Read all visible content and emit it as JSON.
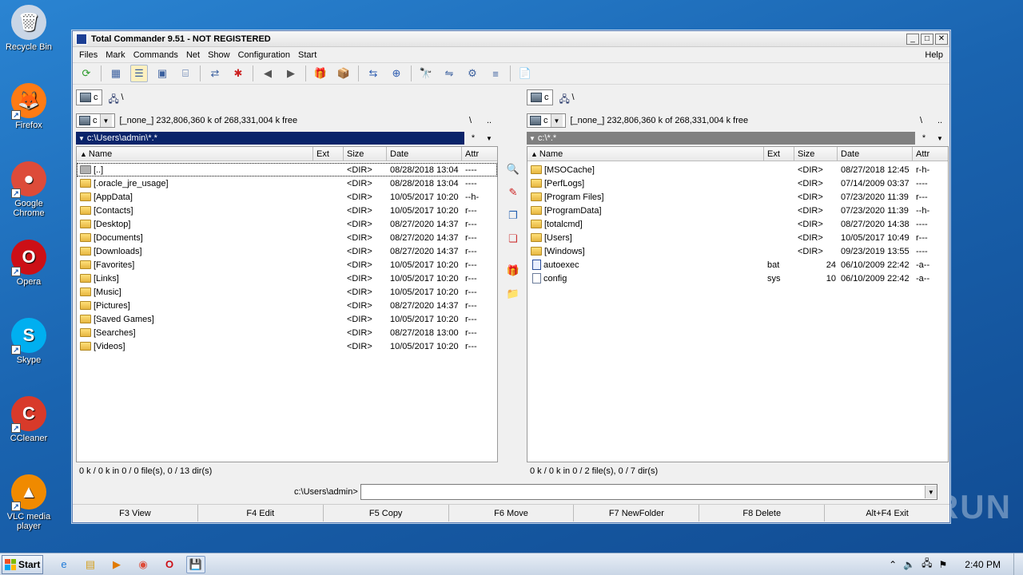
{
  "desktop": {
    "icons": [
      {
        "label": "Recycle Bin",
        "glyph": "🗑",
        "color": "#c9d6e6"
      },
      {
        "label": "Firefox",
        "glyph": "🦊",
        "color": "#ff7b14"
      },
      {
        "label": "Google Chrome",
        "glyph": "●",
        "color": "#dd4b39"
      },
      {
        "label": "Opera",
        "glyph": "O",
        "color": "#cc0f16"
      },
      {
        "label": "Skype",
        "glyph": "S",
        "color": "#00aff0"
      },
      {
        "label": "CCleaner",
        "glyph": "C",
        "color": "#d83a2a"
      },
      {
        "label": "VLC media player",
        "glyph": "▲",
        "color": "#f08a00"
      }
    ]
  },
  "window": {
    "title": "Total Commander 9.51 - NOT REGISTERED",
    "menu": [
      "Files",
      "Mark",
      "Commands",
      "Net",
      "Show",
      "Configuration",
      "Start"
    ],
    "help": "Help",
    "toolbar_icons": [
      "refresh-icon",
      "brief-view-icon",
      "full-view-icon",
      "thumbnail-view-icon",
      "tree-view-icon",
      "invert-selection-icon",
      "configure-icon",
      "back-icon",
      "forward-icon",
      "pack-icon",
      "unpack-icon",
      "ftp-icon",
      "url-icon",
      "search-icon",
      "sync-dirs-icon",
      "multi-rename-icon",
      "compare-icon",
      "notepad-icon"
    ]
  },
  "left": {
    "drive": "c",
    "drive_letter": "c",
    "root": "\\",
    "free": "[_none_]  232,806,360 k of 268,331,004 k free",
    "backslash": "\\",
    "dotdot": "..",
    "path": "c:\\Users\\admin\\*.*",
    "star": "*",
    "headers": {
      "name": "Name",
      "ext": "Ext",
      "size": "Size",
      "date": "Date",
      "attr": "Attr"
    },
    "rows": [
      {
        "name": "[..]",
        "ext": "",
        "size": "<DIR>",
        "date": "08/28/2018 13:04",
        "attr": "----",
        "kind": "up"
      },
      {
        "name": "[.oracle_jre_usage]",
        "ext": "",
        "size": "<DIR>",
        "date": "08/28/2018 13:04",
        "attr": "----",
        "kind": "dir"
      },
      {
        "name": "[AppData]",
        "ext": "",
        "size": "<DIR>",
        "date": "10/05/2017 10:20",
        "attr": "--h-",
        "kind": "dir"
      },
      {
        "name": "[Contacts]",
        "ext": "",
        "size": "<DIR>",
        "date": "10/05/2017 10:20",
        "attr": "r---",
        "kind": "dir"
      },
      {
        "name": "[Desktop]",
        "ext": "",
        "size": "<DIR>",
        "date": "08/27/2020 14:37",
        "attr": "r---",
        "kind": "dir"
      },
      {
        "name": "[Documents]",
        "ext": "",
        "size": "<DIR>",
        "date": "08/27/2020 14:37",
        "attr": "r---",
        "kind": "dir"
      },
      {
        "name": "[Downloads]",
        "ext": "",
        "size": "<DIR>",
        "date": "08/27/2020 14:37",
        "attr": "r---",
        "kind": "dir"
      },
      {
        "name": "[Favorites]",
        "ext": "",
        "size": "<DIR>",
        "date": "10/05/2017 10:20",
        "attr": "r---",
        "kind": "dir"
      },
      {
        "name": "[Links]",
        "ext": "",
        "size": "<DIR>",
        "date": "10/05/2017 10:20",
        "attr": "r---",
        "kind": "dir"
      },
      {
        "name": "[Music]",
        "ext": "",
        "size": "<DIR>",
        "date": "10/05/2017 10:20",
        "attr": "r---",
        "kind": "dir"
      },
      {
        "name": "[Pictures]",
        "ext": "",
        "size": "<DIR>",
        "date": "08/27/2020 14:37",
        "attr": "r---",
        "kind": "dir"
      },
      {
        "name": "[Saved Games]",
        "ext": "",
        "size": "<DIR>",
        "date": "10/05/2017 10:20",
        "attr": "r---",
        "kind": "dir"
      },
      {
        "name": "[Searches]",
        "ext": "",
        "size": "<DIR>",
        "date": "08/27/2018 13:00",
        "attr": "r---",
        "kind": "dir"
      },
      {
        "name": "[Videos]",
        "ext": "",
        "size": "<DIR>",
        "date": "10/05/2017 10:20",
        "attr": "r---",
        "kind": "dir"
      }
    ],
    "status": "0 k / 0 k in 0 / 0 file(s), 0 / 13 dir(s)"
  },
  "right": {
    "drive": "c",
    "drive_letter": "c",
    "root": "\\",
    "free": "[_none_]  232,806,360 k of 268,331,004 k free",
    "backslash": "\\",
    "dotdot": "..",
    "path": "c:\\*.*",
    "star": "*",
    "headers": {
      "name": "Name",
      "ext": "Ext",
      "size": "Size",
      "date": "Date",
      "attr": "Attr"
    },
    "rows": [
      {
        "name": "[MSOCache]",
        "ext": "",
        "size": "<DIR>",
        "date": "08/27/2018 12:45",
        "attr": "r-h-",
        "kind": "dir"
      },
      {
        "name": "[PerfLogs]",
        "ext": "",
        "size": "<DIR>",
        "date": "07/14/2009 03:37",
        "attr": "----",
        "kind": "dir"
      },
      {
        "name": "[Program Files]",
        "ext": "",
        "size": "<DIR>",
        "date": "07/23/2020 11:39",
        "attr": "r---",
        "kind": "dir"
      },
      {
        "name": "[ProgramData]",
        "ext": "",
        "size": "<DIR>",
        "date": "07/23/2020 11:39",
        "attr": "--h-",
        "kind": "dir"
      },
      {
        "name": "[totalcmd]",
        "ext": "",
        "size": "<DIR>",
        "date": "08/27/2020 14:38",
        "attr": "----",
        "kind": "dir"
      },
      {
        "name": "[Users]",
        "ext": "",
        "size": "<DIR>",
        "date": "10/05/2017 10:49",
        "attr": "r---",
        "kind": "dir"
      },
      {
        "name": "[Windows]",
        "ext": "",
        "size": "<DIR>",
        "date": "09/23/2019 13:55",
        "attr": "----",
        "kind": "dir"
      },
      {
        "name": "autoexec",
        "ext": "bat",
        "size": "24",
        "date": "06/10/2009 22:42",
        "attr": "-a--",
        "kind": "exe"
      },
      {
        "name": "config",
        "ext": "sys",
        "size": "10",
        "date": "06/10/2009 22:42",
        "attr": "-a--",
        "kind": "file"
      }
    ],
    "status": "0 k / 0 k in 0 / 2 file(s), 0 / 7 dir(s)"
  },
  "cmdline": {
    "label": "c:\\Users\\admin>",
    "value": ""
  },
  "fkeys": [
    "F3 View",
    "F4 Edit",
    "F5 Copy",
    "F6 Move",
    "F7 NewFolder",
    "F8 Delete",
    "Alt+F4 Exit"
  ],
  "taskbar": {
    "start": "Start",
    "apps": [
      "ie-icon",
      "explorer-icon",
      "media-player-icon",
      "chrome-icon",
      "opera-icon",
      "total-commander-icon"
    ],
    "clock": "2:40 PM"
  },
  "watermark": "ANY▷RUN"
}
